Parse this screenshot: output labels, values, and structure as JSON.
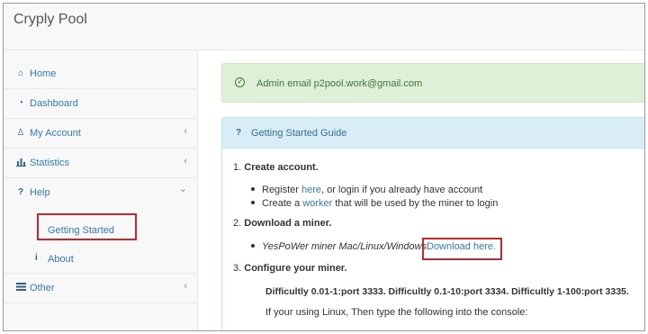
{
  "app": {
    "brand": "Cryply Pool"
  },
  "sidebar": {
    "items": [
      {
        "label": "Home",
        "icon": "home-icon"
      },
      {
        "label": "Dashboard",
        "icon": "dashboard-icon"
      },
      {
        "label": "My Account",
        "icon": "account-icon",
        "chevron": "‹"
      },
      {
        "label": "Statistics",
        "icon": "statistics-icon",
        "chevron": "‹"
      },
      {
        "label": "Help",
        "icon": "help-icon",
        "chevron": "⌄"
      },
      {
        "label": "Other",
        "icon": "other-icon",
        "chevron": "‹"
      }
    ],
    "help_sub": [
      {
        "label": "Getting Started"
      },
      {
        "label": "About",
        "glyph": "i"
      }
    ]
  },
  "alert": {
    "message": "Admin email p2pool.work@gmail.com"
  },
  "guide": {
    "title": "Getting Started Guide",
    "step1": {
      "num": "1.",
      "title": "Create account."
    },
    "step1_b1": {
      "pre": "Register ",
      "link": "here",
      "post": ", or login if you already have account"
    },
    "step1_b2": {
      "pre": "Create a ",
      "link": "worker",
      "post": " that will be used by the miner to login"
    },
    "step2": {
      "num": "2.",
      "title": "Download a miner."
    },
    "step2_b1": {
      "em": "YesPoWer miner Mac/Linux/Windows",
      "link": "Download here."
    },
    "step3": {
      "num": "3.",
      "title": "Configure your miner."
    },
    "difficulty": "Difficultly 0.01-1:port 3333. Difficultly 0.1-10:port 3334. Difficultly 1-100:port 3335.",
    "linux_note": "If your using Linux, Then type the following into the console:"
  },
  "colors": {
    "accent_link": "#337ab7",
    "highlight_box": "#c9252c",
    "alert_bg": "#dff0d8",
    "panel_head_bg": "#d9edf7"
  }
}
